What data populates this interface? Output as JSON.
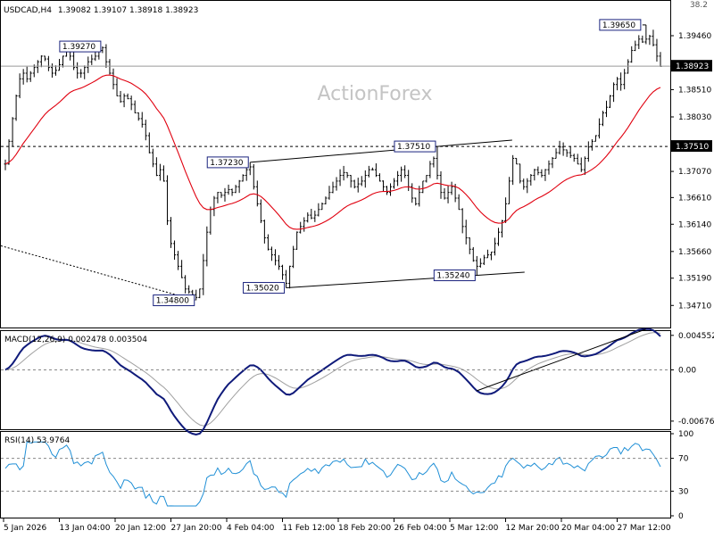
{
  "header": {
    "symbol_timeframe": "USDCAD,H4",
    "ohlc": "1.39082 1.39107 1.38918 1.38923",
    "corner_value": "38.2"
  },
  "watermark": "ActionForex",
  "colors": {
    "bars": "#000000",
    "ma": "#e0000f",
    "macd_main": "#0f1a7a",
    "macd_signal": "#a0a0a0",
    "rsi": "#1f8fd6",
    "grid": "#888888",
    "label_box": "#1a237e"
  },
  "chart_data": [
    {
      "type": "candlestick",
      "name": "price",
      "ylim": [
        1.344,
        1.399
      ],
      "y_ticks": [
        "1.39460",
        "1.38510",
        "1.38030",
        "1.37070",
        "1.36610",
        "1.36140",
        "1.35660",
        "1.35190",
        "1.34710"
      ],
      "price_tag": "1.38923",
      "current_price": 1.38923,
      "level_tag": "1.37510",
      "level": 1.3751,
      "annotations": [
        {
          "label": "1.39270",
          "value": 1.3927,
          "bar": 27
        },
        {
          "label": "1.37230",
          "value": 1.3723,
          "bar": 68
        },
        {
          "label": "1.34800",
          "value": 1.348,
          "bar": 53
        },
        {
          "label": "1.35020",
          "value": 1.3502,
          "bar": 78
        },
        {
          "label": "1.37510",
          "value": 1.3751,
          "bar": 120
        },
        {
          "label": "1.35240",
          "value": 1.3524,
          "bar": 131
        },
        {
          "label": "1.39650",
          "value": 1.3965,
          "bar": 178
        }
      ],
      "series": [
        {
          "name": "",
          "values": [
            1.372,
            1.376,
            1.38,
            1.384,
            1.387,
            1.388,
            1.387,
            1.388,
            1.389,
            1.39,
            1.391,
            1.3905,
            1.389,
            1.388,
            1.3885,
            1.3895,
            1.391,
            1.392,
            1.391,
            1.389,
            1.388,
            1.388,
            1.389,
            1.39,
            1.3905,
            1.391,
            1.392,
            1.3925,
            1.39,
            1.388,
            1.386,
            1.384,
            1.383,
            1.384,
            1.3835,
            1.3825,
            1.381,
            1.38,
            1.379,
            1.377,
            1.374,
            1.372,
            1.37,
            1.371,
            1.369,
            1.362,
            1.358,
            1.356,
            1.354,
            1.352,
            1.35,
            1.3495,
            1.349,
            1.3485,
            1.35,
            1.355,
            1.36,
            1.364,
            1.366,
            1.367,
            1.3665,
            1.367,
            1.3675,
            1.367,
            1.368,
            1.369,
            1.37,
            1.371,
            1.3715,
            1.368,
            1.365,
            1.362,
            1.359,
            1.357,
            1.356,
            1.355,
            1.354,
            1.3525,
            1.351,
            1.354,
            1.357,
            1.36,
            1.361,
            1.362,
            1.363,
            1.3625,
            1.363,
            1.364,
            1.365,
            1.366,
            1.367,
            1.368,
            1.369,
            1.37,
            1.3705,
            1.37,
            1.369,
            1.368,
            1.3685,
            1.369,
            1.37,
            1.371,
            1.371,
            1.37,
            1.369,
            1.368,
            1.367,
            1.368,
            1.369,
            1.37,
            1.371,
            1.37,
            1.368,
            1.366,
            1.365,
            1.367,
            1.369,
            1.37,
            1.372,
            1.373,
            1.37,
            1.367,
            1.366,
            1.367,
            1.368,
            1.366,
            1.364,
            1.361,
            1.359,
            1.357,
            1.355,
            1.354,
            1.3545,
            1.3555,
            1.356,
            1.3565,
            1.358,
            1.36,
            1.362,
            1.365,
            1.369,
            1.373,
            1.372,
            1.369,
            1.368,
            1.369,
            1.37,
            1.371,
            1.3705,
            1.37,
            1.371,
            1.372,
            1.373,
            1.374,
            1.375,
            1.3745,
            1.374,
            1.3735,
            1.373,
            1.372,
            1.371,
            1.373,
            1.375,
            1.376,
            1.377,
            1.379,
            1.381,
            1.382,
            1.384,
            1.386,
            1.387,
            1.386,
            1.388,
            1.39,
            1.392,
            1.393,
            1.394,
            1.3935,
            1.394,
            1.3945,
            1.393,
            1.391,
            1.3892
          ]
        }
      ]
    },
    {
      "type": "line",
      "name": "macd",
      "label": "MACD(12,26,9) 0.002478 0.003504",
      "ylim": [
        -0.0076,
        0.005
      ],
      "y_ticks": [
        "0.004552",
        "0.00",
        "-0.006764"
      ]
    },
    {
      "type": "line",
      "name": "rsi",
      "label": "RSI(14) 53.9764",
      "ylim": [
        0,
        100
      ],
      "y_ticks": [
        "100",
        "70",
        "30",
        "0"
      ]
    }
  ],
  "x_axis": {
    "labels": [
      "5 Jan 2026",
      "13 Jan 04:00",
      "20 Jan 12:00",
      "27 Jan 20:00",
      "4 Feb 04:00",
      "11 Feb 12:00",
      "18 Feb 20:00",
      "26 Feb 04:00",
      "5 Mar 12:00",
      "12 Mar 20:00",
      "20 Mar 04:00",
      "27 Mar 12:00"
    ]
  }
}
